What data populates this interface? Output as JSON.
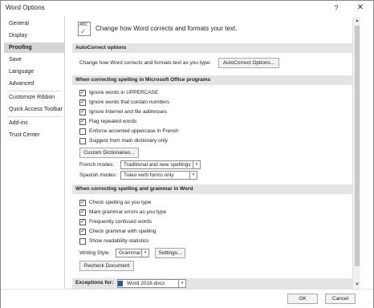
{
  "window": {
    "title": "Word Options",
    "help": "?",
    "close": "✕"
  },
  "sidebar": {
    "items": [
      {
        "label": "General"
      },
      {
        "label": "Display"
      },
      {
        "label": "Proofing"
      },
      {
        "label": "Save"
      },
      {
        "label": "Language"
      },
      {
        "label": "Advanced"
      },
      {
        "label": "Customize Ribbon"
      },
      {
        "label": "Quick Access Toolbar"
      },
      {
        "label": "Add-ins"
      },
      {
        "label": "Trust Center"
      }
    ],
    "active": "Proofing"
  },
  "header": {
    "text": "Change how Word corrects and formats your text.",
    "icon": "abc-check-icon",
    "icon_text": "ABC"
  },
  "autocorrect": {
    "title": "AutoCorrect options",
    "description": "Change how Word corrects and formats text as you type:",
    "button": "AutoCorrect Options..."
  },
  "office_spelling": {
    "title": "When correcting spelling in Microsoft Office programs",
    "options": [
      {
        "label": "Ignore words in UPPERCASE",
        "checked": true
      },
      {
        "label": "Ignore words that contain numbers",
        "checked": true
      },
      {
        "label": "Ignore Internet and file addresses",
        "checked": true
      },
      {
        "label": "Flag repeated words",
        "checked": true
      },
      {
        "label": "Enforce accented uppercase in French",
        "checked": false
      },
      {
        "label": "Suggest from main dictionary only",
        "checked": false
      }
    ],
    "custom_dict_button": "Custom Dictionaries...",
    "french_label": "French modes:",
    "french_value": "Traditional and new spellings",
    "spanish_label": "Spanish modes:",
    "spanish_value": "Tuteo verb forms only"
  },
  "word_spelling": {
    "title": "When correcting spelling and grammar in Word",
    "options": [
      {
        "label": "Check spelling as you type",
        "checked": true
      },
      {
        "label": "Mark grammar errors as you type",
        "checked": true
      },
      {
        "label": "Frequently confused words",
        "checked": true
      },
      {
        "label": "Check grammar with spelling",
        "checked": true
      },
      {
        "label": "Show readability statistics",
        "checked": false
      }
    ],
    "writing_style_label": "Writing Style:",
    "writing_style_value": "Grammar",
    "settings_button": "Settings...",
    "recheck_button": "Recheck Document"
  },
  "exceptions": {
    "label": "Exceptions for:",
    "value": "Word 2016.docx"
  },
  "footer": {
    "ok": "OK",
    "cancel": "Cancel"
  },
  "glyphs": {
    "check": "✓",
    "chevron": "▾",
    "up": "▲",
    "down": "▼",
    "grip": "⋰"
  }
}
